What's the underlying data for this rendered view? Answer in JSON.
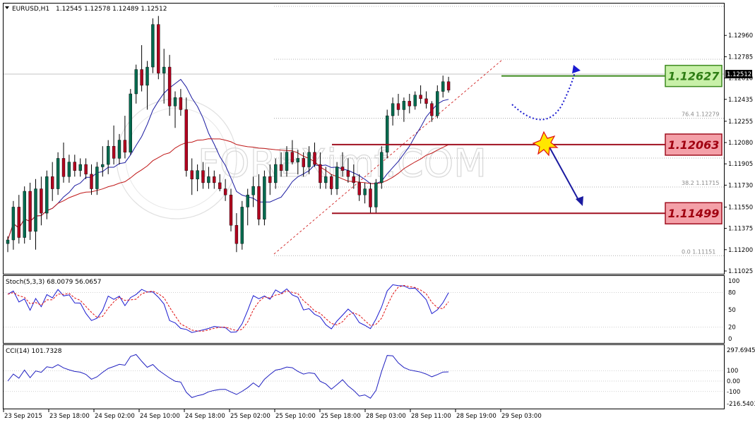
{
  "header": {
    "symbol": "EURUSD,H1",
    "ohlc": "1.12545 1.12578 1.12489 1.12512"
  },
  "watermark": "FOREXimf.COM",
  "price_axis": {
    "ticks": [
      "1.12960",
      "1.12785",
      "1.12610",
      "1.12435",
      "1.12255",
      "1.12080",
      "1.11905",
      "1.11730",
      "1.11550",
      "1.11375",
      "1.11200",
      "1.11025"
    ],
    "current_price": "1.12512"
  },
  "time_axis": {
    "labels": [
      "23 Sep 2015",
      "23 Sep 18:00",
      "24 Sep 02:00",
      "24 Sep 10:00",
      "24 Sep 18:00",
      "25 Sep 02:00",
      "25 Sep 10:00",
      "25 Sep 18:00",
      "28 Sep 03:00",
      "28 Sep 11:00",
      "28 Sep 19:00",
      "29 Sep 03:00"
    ]
  },
  "fib_levels": [
    {
      "label": "76.4  1.12279"
    },
    {
      "label": "38.2  1.11715"
    },
    {
      "label": "0.0  1.11151"
    }
  ],
  "levels": [
    {
      "value": "1.12627",
      "kind": "resistance",
      "line_color": "#3c8a1e",
      "box_fill": "#c8f0a8",
      "text_color": "#2e7d14"
    },
    {
      "value": "1.12063",
      "kind": "pivot",
      "line_color": "#a01020",
      "box_fill": "#f4a0a8",
      "text_color": "#a00010"
    },
    {
      "value": "1.11499",
      "kind": "support",
      "line_color": "#a01020",
      "box_fill": "#f4a0a8",
      "text_color": "#a00010"
    }
  ],
  "stoch_panel": {
    "label": "Stoch(5,3,3) 68.0079 56.0657",
    "ticks": [
      "100",
      "80",
      "50",
      "20",
      "0"
    ]
  },
  "cci_panel": {
    "label": "CCI(14) 101.7328",
    "ticks": [
      "297.6945",
      "100",
      "0.00",
      "-100",
      "-216.5403"
    ]
  },
  "colors": {
    "bull": "#006a4e",
    "bear": "#b0001e",
    "ma_fast": "#1a1aa0",
    "ma_slow": "#c01818",
    "stoch_main": "#1a1ad0",
    "stoch_signal": "#e01010",
    "cci": "#2020c0"
  },
  "chart_data": {
    "type": "candlestick",
    "title": "EURUSD,H1",
    "ylim": [
      1.11025,
      1.13135
    ],
    "candles": [
      [
        1.1125,
        1.1131,
        1.1118,
        1.1128
      ],
      [
        1.1128,
        1.116,
        1.112,
        1.1155
      ],
      [
        1.1155,
        1.1165,
        1.1125,
        1.113
      ],
      [
        1.113,
        1.1172,
        1.1125,
        1.1168
      ],
      [
        1.1168,
        1.1175,
        1.1128,
        1.1135
      ],
      [
        1.1135,
        1.1178,
        1.112,
        1.117
      ],
      [
        1.117,
        1.118,
        1.114,
        1.115
      ],
      [
        1.115,
        1.1185,
        1.1145,
        1.118
      ],
      [
        1.118,
        1.1192,
        1.116,
        1.117
      ],
      [
        1.117,
        1.12,
        1.1165,
        1.1195
      ],
      [
        1.1195,
        1.1208,
        1.1175,
        1.118
      ],
      [
        1.118,
        1.1198,
        1.1175,
        1.1192
      ],
      [
        1.1192,
        1.1198,
        1.118,
        1.1185
      ],
      [
        1.1185,
        1.1195,
        1.118,
        1.119
      ],
      [
        1.119,
        1.1195,
        1.1178,
        1.1182
      ],
      [
        1.1182,
        1.119,
        1.1165,
        1.117
      ],
      [
        1.117,
        1.1192,
        1.1165,
        1.1188
      ],
      [
        1.1188,
        1.1205,
        1.118,
        1.119
      ],
      [
        1.119,
        1.121,
        1.1182,
        1.1205
      ],
      [
        1.1205,
        1.1222,
        1.119,
        1.1195
      ],
      [
        1.1195,
        1.1215,
        1.119,
        1.121
      ],
      [
        1.121,
        1.123,
        1.1195,
        1.12
      ],
      [
        1.12,
        1.1252,
        1.1198,
        1.1248
      ],
      [
        1.1248,
        1.1272,
        1.124,
        1.1268
      ],
      [
        1.1268,
        1.1288,
        1.125,
        1.1255
      ],
      [
        1.1255,
        1.1275,
        1.1235,
        1.127
      ],
      [
        1.127,
        1.131,
        1.1265,
        1.1305
      ],
      [
        1.1305,
        1.1312,
        1.126,
        1.1265
      ],
      [
        1.1265,
        1.1285,
        1.124,
        1.127
      ],
      [
        1.127,
        1.128,
        1.123,
        1.1238
      ],
      [
        1.1238,
        1.125,
        1.122,
        1.1245
      ],
      [
        1.1245,
        1.1252,
        1.123,
        1.1235
      ],
      [
        1.1235,
        1.1245,
        1.118,
        1.1185
      ],
      [
        1.1185,
        1.1195,
        1.1165,
        1.1178
      ],
      [
        1.1178,
        1.119,
        1.1168,
        1.1185
      ],
      [
        1.1185,
        1.1192,
        1.117,
        1.1175
      ],
      [
        1.1175,
        1.1188,
        1.117,
        1.118
      ],
      [
        1.118,
        1.1185,
        1.117,
        1.1175
      ],
      [
        1.1175,
        1.1182,
        1.1168,
        1.117
      ],
      [
        1.117,
        1.1178,
        1.116,
        1.1165
      ],
      [
        1.1165,
        1.117,
        1.1135,
        1.114
      ],
      [
        1.114,
        1.115,
        1.1118,
        1.1125
      ],
      [
        1.1125,
        1.116,
        1.112,
        1.1155
      ],
      [
        1.1155,
        1.117,
        1.114,
        1.1165
      ],
      [
        1.1165,
        1.118,
        1.1155,
        1.1172
      ],
      [
        1.1172,
        1.1182,
        1.114,
        1.1145
      ],
      [
        1.1145,
        1.1185,
        1.114,
        1.118
      ],
      [
        1.118,
        1.119,
        1.1165,
        1.1175
      ],
      [
        1.1175,
        1.1195,
        1.117,
        1.119
      ],
      [
        1.119,
        1.12,
        1.118,
        1.1185
      ],
      [
        1.1185,
        1.1205,
        1.118,
        1.12
      ],
      [
        1.12,
        1.121,
        1.119,
        1.1192
      ],
      [
        1.1192,
        1.1202,
        1.1182,
        1.1195
      ],
      [
        1.1195,
        1.12,
        1.118,
        1.1188
      ],
      [
        1.1188,
        1.1205,
        1.1182,
        1.12
      ],
      [
        1.12,
        1.1208,
        1.1188,
        1.119
      ],
      [
        1.119,
        1.12,
        1.117,
        1.1175
      ],
      [
        1.1175,
        1.1188,
        1.117,
        1.118
      ],
      [
        1.118,
        1.1182,
        1.1165,
        1.117
      ],
      [
        1.117,
        1.1192,
        1.1165,
        1.1188
      ],
      [
        1.1188,
        1.12,
        1.118,
        1.1185
      ],
      [
        1.1185,
        1.1195,
        1.1175,
        1.118
      ],
      [
        1.118,
        1.119,
        1.117,
        1.1175
      ],
      [
        1.1175,
        1.1182,
        1.116,
        1.1165
      ],
      [
        1.1165,
        1.1175,
        1.1158,
        1.117
      ],
      [
        1.117,
        1.1175,
        1.115,
        1.1155
      ],
      [
        1.1155,
        1.1178,
        1.115,
        1.1175
      ],
      [
        1.1175,
        1.1205,
        1.117,
        1.12
      ],
      [
        1.12,
        1.1235,
        1.1195,
        1.123
      ],
      [
        1.123,
        1.1245,
        1.1222,
        1.124
      ],
      [
        1.124,
        1.1248,
        1.123,
        1.1235
      ],
      [
        1.1235,
        1.1245,
        1.1225,
        1.1242
      ],
      [
        1.1242,
        1.1248,
        1.1232,
        1.1238
      ],
      [
        1.1238,
        1.125,
        1.1235,
        1.1247
      ],
      [
        1.1247,
        1.1255,
        1.124,
        1.1244
      ],
      [
        1.1244,
        1.125,
        1.1236,
        1.124
      ],
      [
        1.124,
        1.1242,
        1.1225,
        1.123
      ],
      [
        1.123,
        1.1255,
        1.1228,
        1.125
      ],
      [
        1.125,
        1.1263,
        1.1245,
        1.1258
      ],
      [
        1.1258,
        1.1262,
        1.1249,
        1.1251
      ]
    ]
  }
}
